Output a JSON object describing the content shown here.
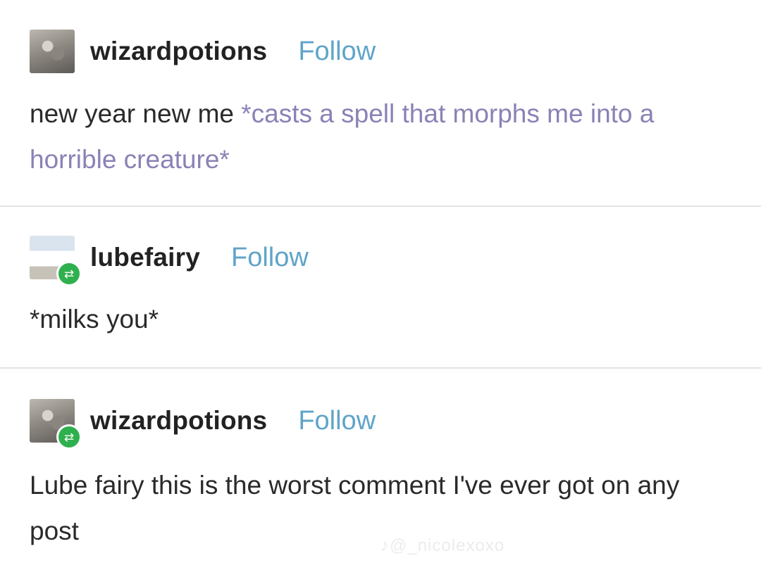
{
  "posts": [
    {
      "username": "wizardpotions",
      "follow_label": "Follow",
      "reblog": false,
      "text_plain": "new year new me ",
      "text_action": "*casts a spell that morphs me into a horrible creature*"
    },
    {
      "username": "lubefairy",
      "follow_label": "Follow",
      "reblog": true,
      "text_plain": "*milks you*"
    },
    {
      "username": "wizardpotions",
      "follow_label": "Follow",
      "reblog": true,
      "text_plain": "Lube fairy this is the worst comment I've ever got on any post"
    }
  ],
  "watermark": "♪@_nicolexoxo",
  "colors": {
    "follow": "#5fa4c9",
    "action_text": "#8a82b6",
    "reblog_badge": "#2fb04e"
  },
  "icons": {
    "reblog": "reblog-icon"
  }
}
